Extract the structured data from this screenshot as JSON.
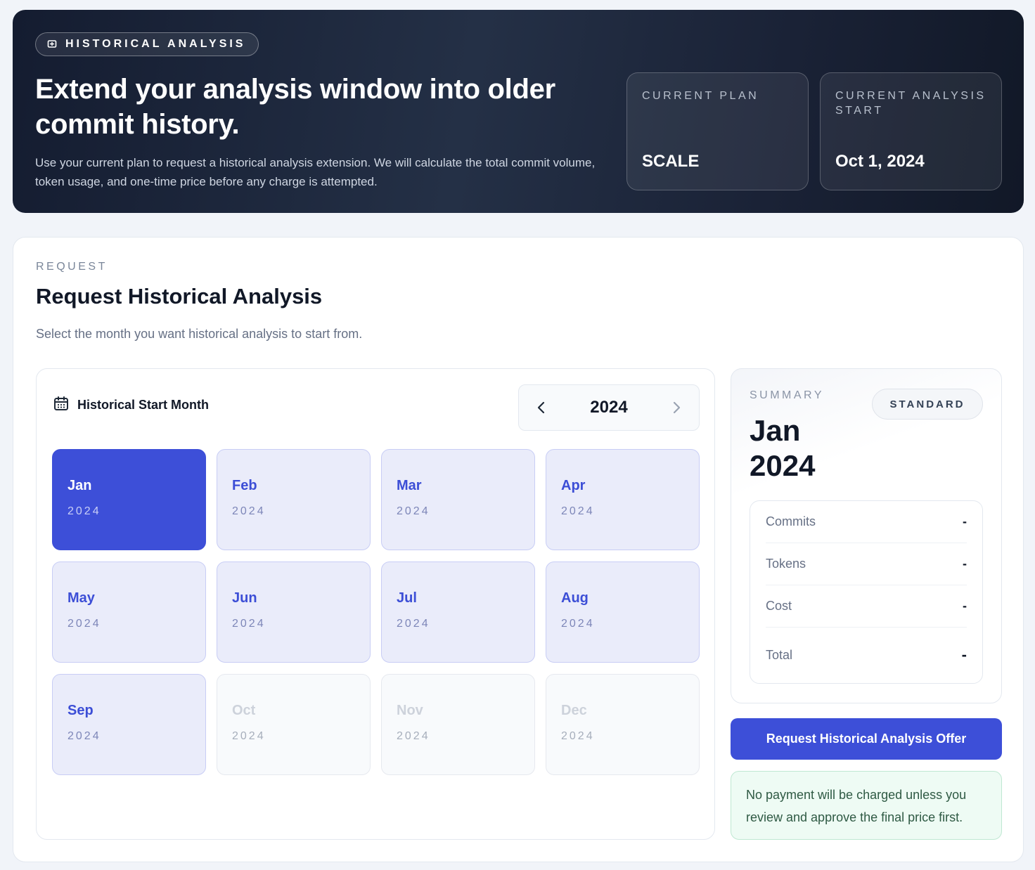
{
  "hero": {
    "pill_label": "HISTORICAL ANALYSIS",
    "title": "Extend your analysis window into older commit history.",
    "description": "Use your current plan to request a historical analysis extension. We will calculate the total commit volume, token usage, and one-time price before any charge is attempted.",
    "stats": [
      {
        "label": "CURRENT PLAN",
        "value": "SCALE"
      },
      {
        "label": "CURRENT ANALYSIS START",
        "value": "Oct 1, 2024"
      }
    ]
  },
  "request": {
    "eyebrow": "REQUEST",
    "title": "Request Historical Analysis",
    "description": "Select the month you want historical analysis to start from."
  },
  "picker": {
    "heading": "Historical Start Month",
    "year": "2024",
    "months": [
      {
        "name": "Jan",
        "year": "2024",
        "state": "selected"
      },
      {
        "name": "Feb",
        "year": "2024",
        "state": "available"
      },
      {
        "name": "Mar",
        "year": "2024",
        "state": "available"
      },
      {
        "name": "Apr",
        "year": "2024",
        "state": "available"
      },
      {
        "name": "May",
        "year": "2024",
        "state": "available"
      },
      {
        "name": "Jun",
        "year": "2024",
        "state": "available"
      },
      {
        "name": "Jul",
        "year": "2024",
        "state": "available"
      },
      {
        "name": "Aug",
        "year": "2024",
        "state": "available"
      },
      {
        "name": "Sep",
        "year": "2024",
        "state": "available"
      },
      {
        "name": "Oct",
        "year": "2024",
        "state": "disabled"
      },
      {
        "name": "Nov",
        "year": "2024",
        "state": "disabled"
      },
      {
        "name": "Dec",
        "year": "2024",
        "state": "disabled"
      }
    ]
  },
  "summary": {
    "label": "SUMMARY",
    "month_line1": "Jan",
    "month_line2": "2024",
    "badge": "STANDARD",
    "metrics": [
      {
        "label": "Commits",
        "value": "-"
      },
      {
        "label": "Tokens",
        "value": "-"
      },
      {
        "label": "Cost",
        "value": "-"
      },
      {
        "label": "Total",
        "value": "-"
      }
    ]
  },
  "cta_label": "Request Historical Analysis Offer",
  "note": "No payment will be charged unless you review and approve the final price first.",
  "colors": {
    "accent": "#3d4fd8",
    "hero_bg": "#1b2336",
    "note_bg": "#eefbf4"
  }
}
